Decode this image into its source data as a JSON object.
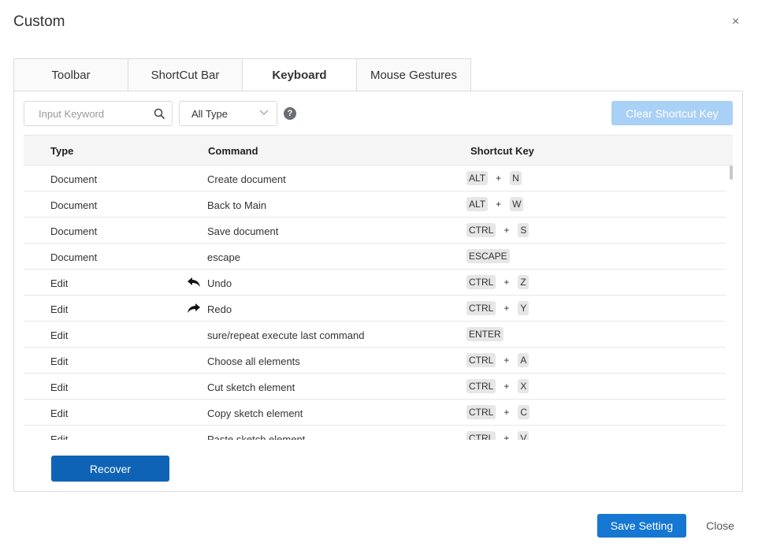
{
  "dialog": {
    "title": "Custom",
    "close_glyph": "×"
  },
  "tabs": [
    {
      "label": "Toolbar",
      "active": false
    },
    {
      "label": "ShortCut Bar",
      "active": false
    },
    {
      "label": "Keyboard",
      "active": true
    },
    {
      "label": "Mouse Gestures",
      "active": false
    }
  ],
  "filters": {
    "search_placeholder": "Input Keyword",
    "search_value": "",
    "type_selected": "All Type",
    "help_glyph": "?",
    "clear_label": "Clear Shortcut Key"
  },
  "table": {
    "headers": {
      "type": "Type",
      "command": "Command",
      "shortcut": "Shortcut Key"
    },
    "rows": [
      {
        "type": "Document",
        "command": "Create document",
        "icon": "",
        "keys": [
          "ALT",
          "N"
        ]
      },
      {
        "type": "Document",
        "command": "Back to Main",
        "icon": "",
        "keys": [
          "ALT",
          "W"
        ]
      },
      {
        "type": "Document",
        "command": "Save document",
        "icon": "",
        "keys": [
          "CTRL",
          "S"
        ]
      },
      {
        "type": "Document",
        "command": "escape",
        "icon": "",
        "keys": [
          "ESCAPE"
        ]
      },
      {
        "type": "Edit",
        "command": "Undo",
        "icon": "undo-arrow-icon",
        "keys": [
          "CTRL",
          "Z"
        ]
      },
      {
        "type": "Edit",
        "command": "Redo",
        "icon": "redo-arrow-icon",
        "keys": [
          "CTRL",
          "Y"
        ]
      },
      {
        "type": "Edit",
        "command": "sure/repeat execute last command",
        "icon": "",
        "keys": [
          "ENTER"
        ]
      },
      {
        "type": "Edit",
        "command": "Choose all elements",
        "icon": "",
        "keys": [
          "CTRL",
          "A"
        ]
      },
      {
        "type": "Edit",
        "command": "Cut sketch element",
        "icon": "",
        "keys": [
          "CTRL",
          "X"
        ]
      },
      {
        "type": "Edit",
        "command": "Copy sketch element",
        "icon": "",
        "keys": [
          "CTRL",
          "C"
        ]
      },
      {
        "type": "Edit",
        "command": "Paste sketch element",
        "icon": "",
        "keys": [
          "CTRL",
          "V"
        ]
      }
    ]
  },
  "footer": {
    "recover_label": "Recover",
    "save_label": "Save Setting",
    "close_label": "Close"
  },
  "colors": {
    "primary": "#1677d2",
    "recover": "#0f63b6",
    "disabled": "#a9d0f5"
  }
}
